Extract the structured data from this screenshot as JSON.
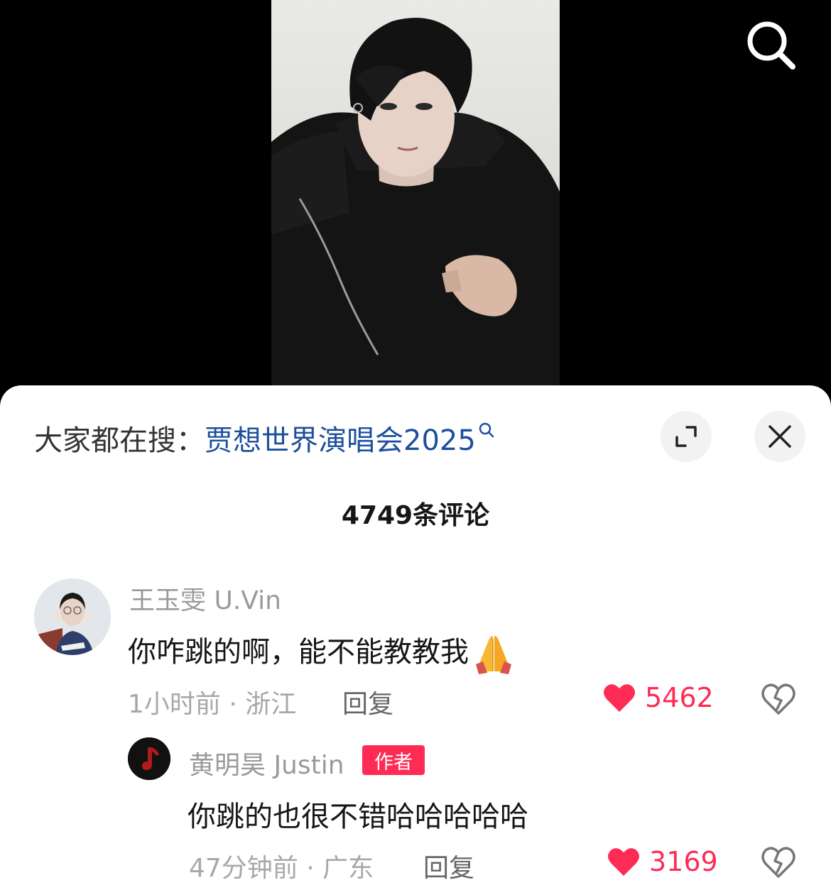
{
  "search": {
    "hot_label": "大家都在搜：",
    "hot_query": "贾想世界演唱会2025"
  },
  "comments_header": {
    "count_text": "4749条评论"
  },
  "comments": [
    {
      "username": "王玉雯 U.Vin",
      "text": "你咋跳的啊，能不能教教我",
      "emoji": "folded-hands",
      "time_location": "1小时前 · 浙江",
      "reply_label": "回复",
      "likes": "5462"
    },
    {
      "username": "黄明昊 Justin",
      "badge": "作者",
      "text": "你跳的也很不错哈哈哈哈哈",
      "time_location": "47分钟前 · 广东",
      "reply_label": "回复",
      "likes": "3169"
    }
  ],
  "icons": {
    "search": "search-icon",
    "expand": "expand-icon",
    "close": "close-icon",
    "like": "heart-icon",
    "dislike": "broken-heart-icon"
  },
  "colors": {
    "like": "#fe2c55",
    "link": "#1d4f9c",
    "badge": "#fe2c55"
  }
}
